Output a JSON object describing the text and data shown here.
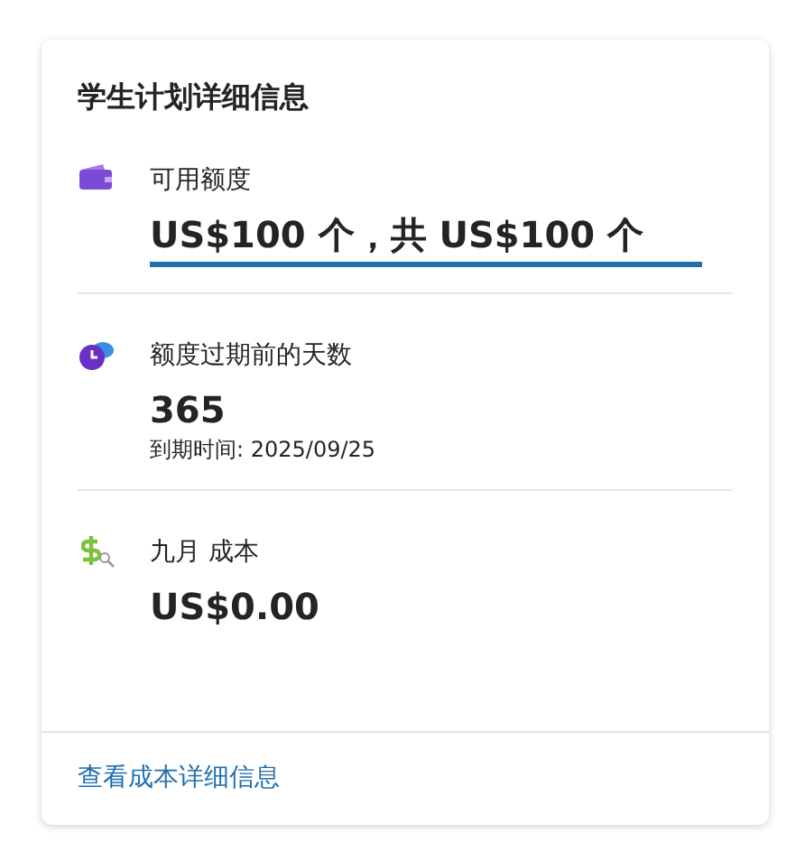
{
  "card": {
    "title": "学生计划详细信息",
    "sections": [
      {
        "kind": "credit",
        "label": "可用额度",
        "value": "US$100 个，共 US$100 个",
        "level": 1
      },
      {
        "kind": "expiry",
        "label": "额度过期前的天数",
        "value": "365",
        "note": "到期时间: 2025/09/25"
      },
      {
        "kind": "cost",
        "label": "九月 成本",
        "value": "US$0.00"
      }
    ],
    "link": "查看成本详细信息"
  }
}
